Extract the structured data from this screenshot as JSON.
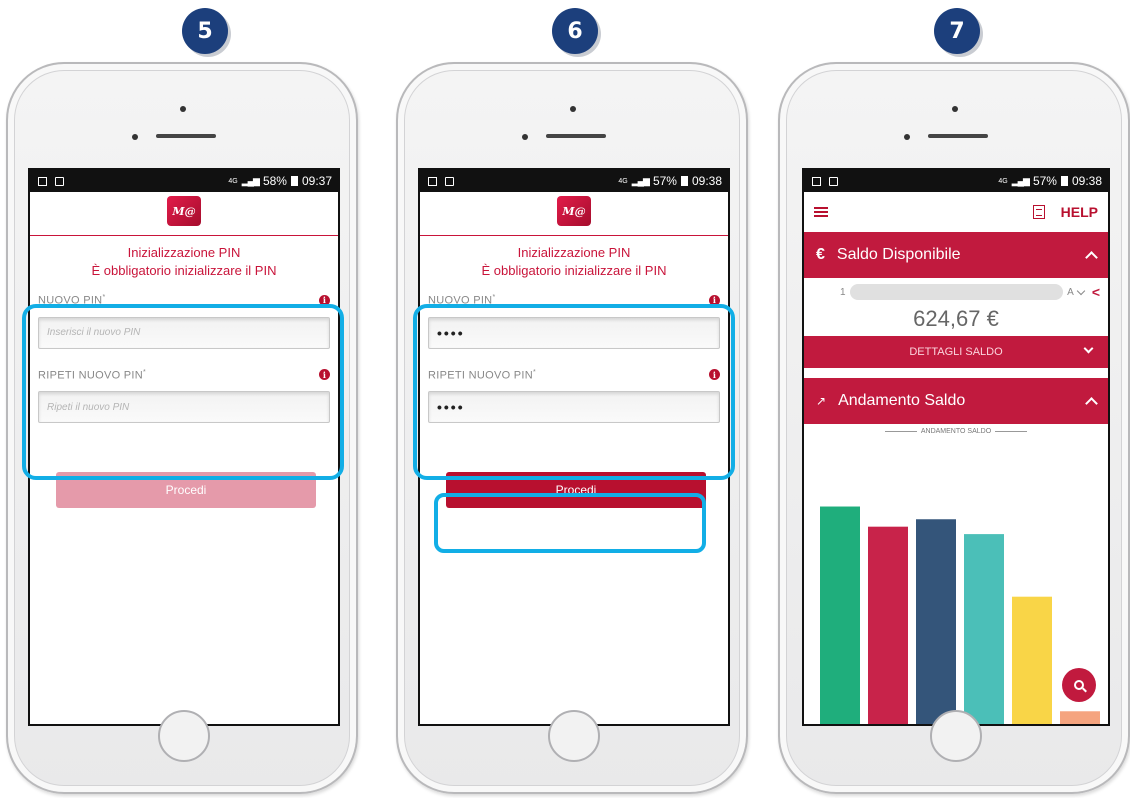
{
  "steps": [
    "5",
    "6",
    "7"
  ],
  "colors": {
    "brand_red": "#c11a3e",
    "highlight_blue": "#12aee6",
    "badge_navy": "#1c3f7c"
  },
  "screen5": {
    "status": {
      "network": "4G",
      "battery": "58%",
      "time": "09:37"
    },
    "logo_text": "M@",
    "title": "Inizializzazione PIN",
    "subtitle": "È obbligatorio inizializzare il PIN",
    "new_pin_label": "NUOVO PIN",
    "new_pin_placeholder": "Inserisci il nuovo PIN",
    "repeat_pin_label": "RIPETI NUOVO PIN",
    "repeat_pin_placeholder": "Ripeti il nuovo PIN",
    "button": "Procedi"
  },
  "screen6": {
    "status": {
      "network": "4G",
      "battery": "57%",
      "time": "09:38"
    },
    "logo_text": "M@",
    "title": "Inizializzazione PIN",
    "subtitle": "È obbligatorio inizializzare il PIN",
    "new_pin_label": "NUOVO PIN",
    "new_pin_value": "••••",
    "repeat_pin_label": "RIPETI NUOVO PIN",
    "repeat_pin_value": "••••",
    "button": "Procedi"
  },
  "screen7": {
    "status": {
      "network": "4G",
      "battery": "57%",
      "time": "09:38"
    },
    "help": "HELP",
    "saldo_header": "Saldo Disponibile",
    "currency_icon": "€",
    "account_prefix": "1",
    "account_suffix": "A",
    "amount": "624,67 €",
    "details_button": "DETTAGLI SALDO",
    "andamento_header": "Andamento Saldo",
    "chart_title": "ANDAMENTO SALDO"
  },
  "chart_data": {
    "type": "bar",
    "title": "ANDAMENTO SALDO",
    "categories": [
      "",
      "",
      "",
      "",
      "",
      ""
    ],
    "values": [
      205,
      186,
      193,
      179,
      120,
      12
    ],
    "colors": [
      "#1fae7c",
      "#c8234a",
      "#34557a",
      "#4bbfb8",
      "#f9d547",
      "#f5a47f"
    ],
    "ylim": [
      0,
      230
    ],
    "grid": false
  }
}
